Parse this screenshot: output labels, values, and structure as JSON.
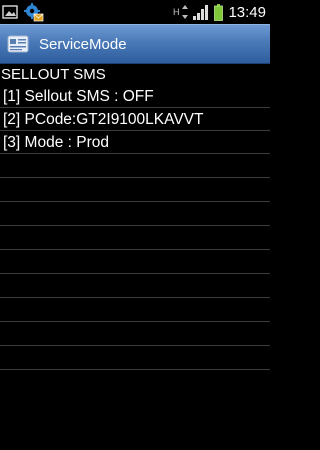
{
  "status_bar": {
    "left_icons": [
      "gallery-icon",
      "settings-mail-icon"
    ],
    "network_label": "H",
    "time": "13:49"
  },
  "titlebar": {
    "title": "ServiceMode"
  },
  "content": {
    "header": "SELLOUT SMS",
    "items": [
      "[1] Sellout SMS : OFF",
      "[2] PCode:GT2I9100LKAVVT",
      "[3] Mode : Prod"
    ]
  }
}
